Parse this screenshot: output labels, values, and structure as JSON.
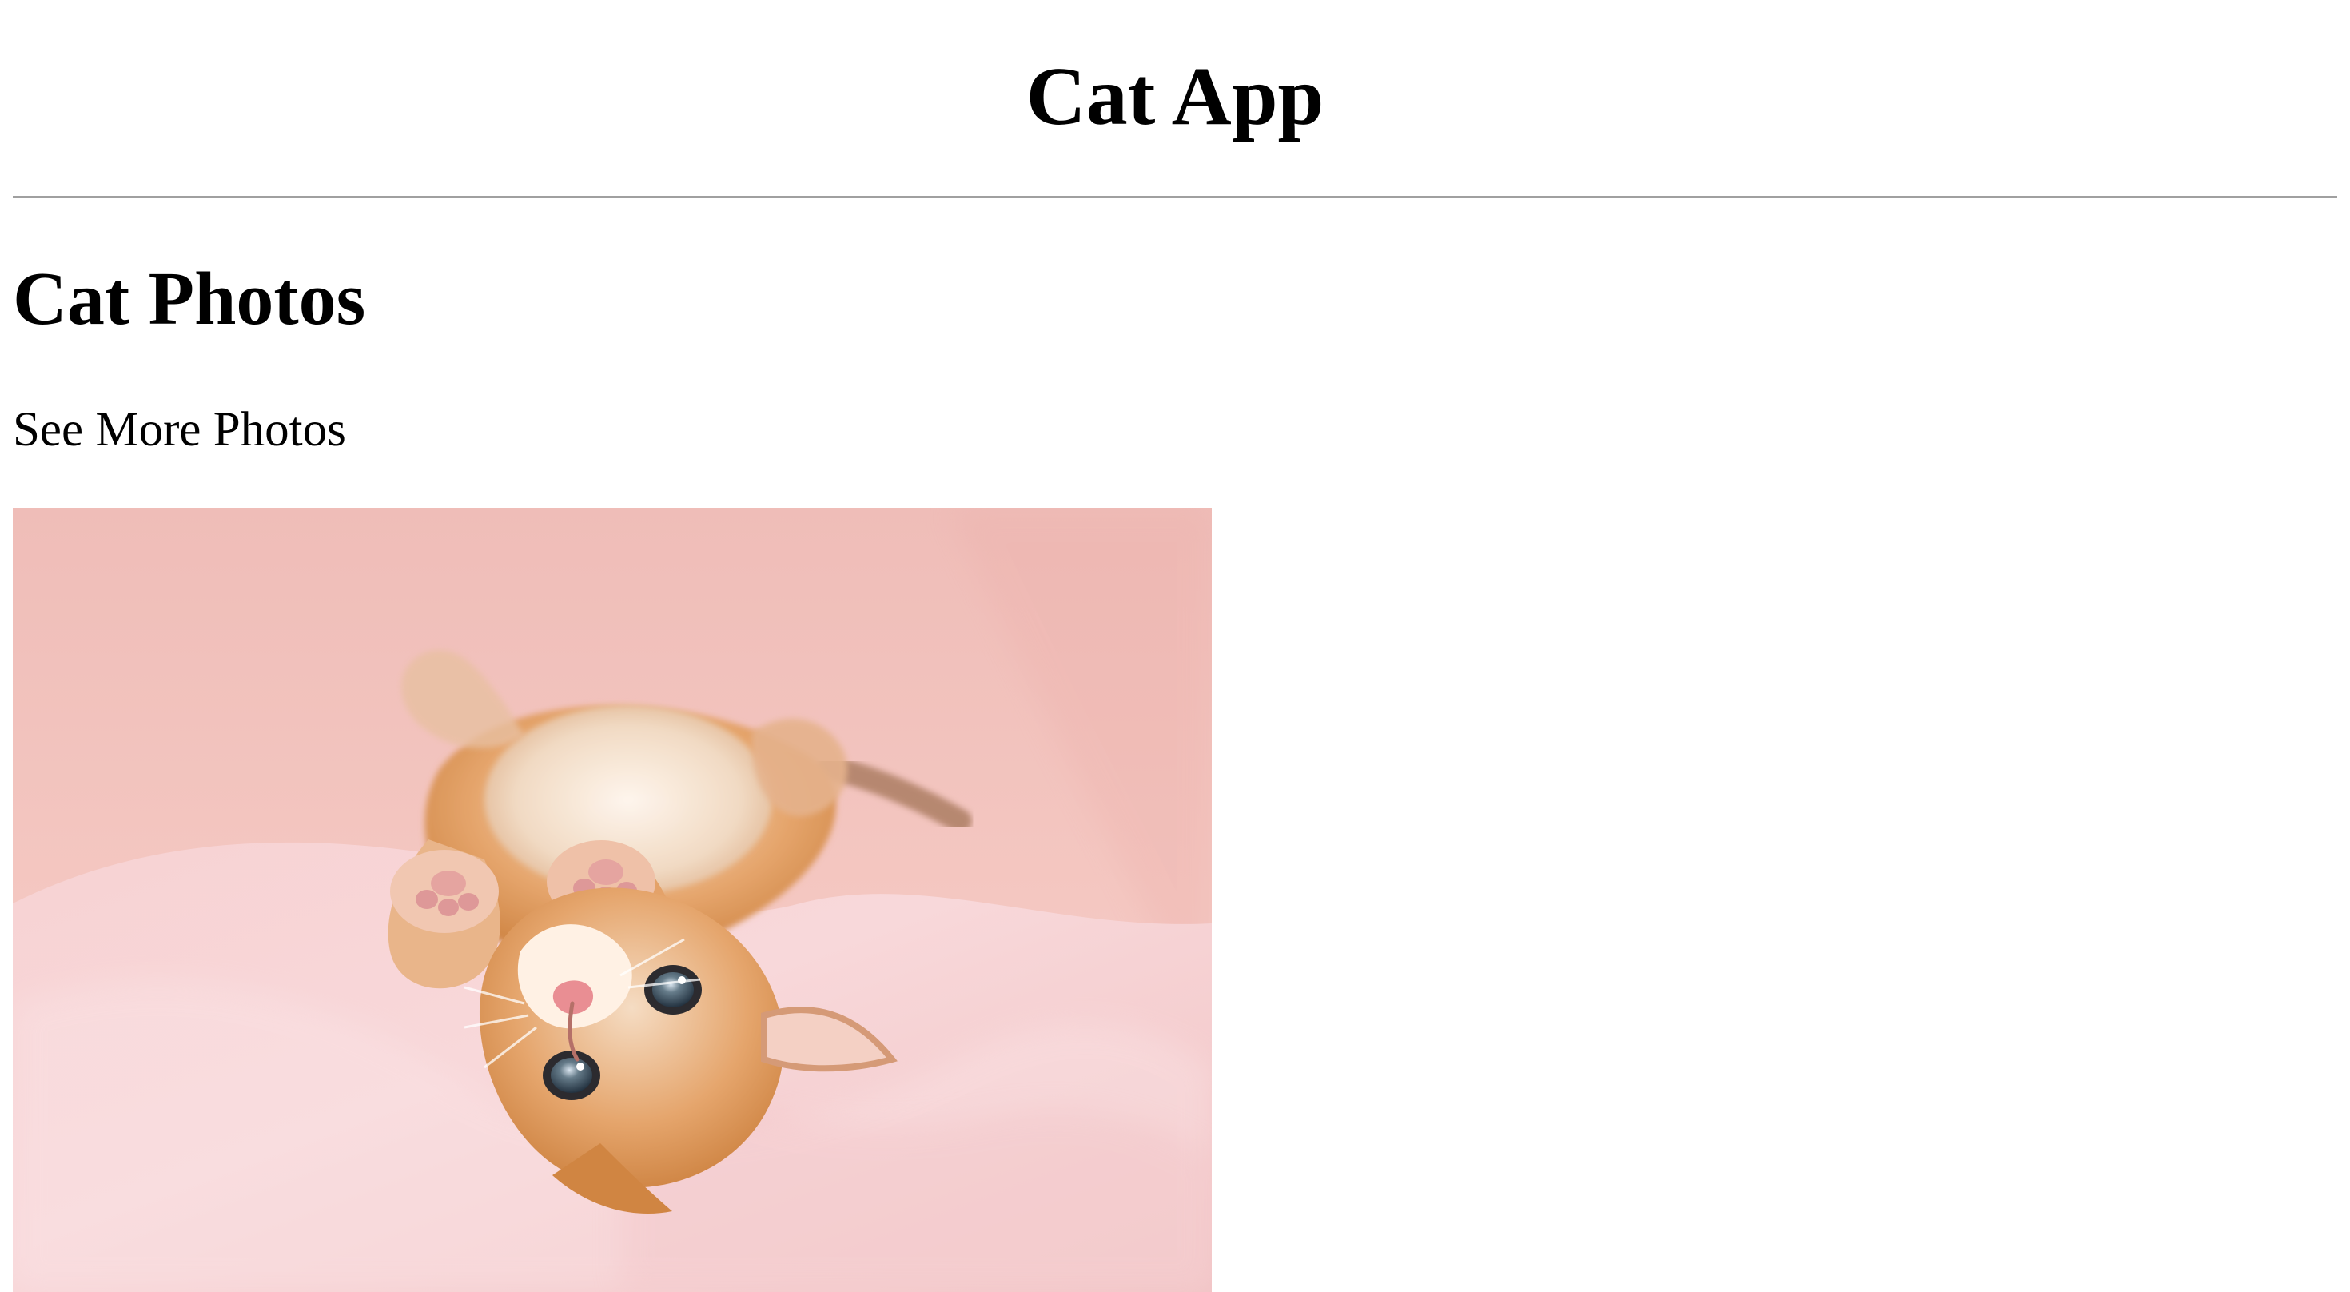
{
  "app": {
    "title": "Cat App"
  },
  "main": {
    "section_heading": "Cat Photos",
    "see_more_link": "See More Photos"
  },
  "photo": {
    "icon": "kitten-photo",
    "colors": {
      "background": "#f6c8c3",
      "blanket": "#f8d6d7",
      "fur": "#d98b47",
      "eye": "#40525f"
    }
  }
}
